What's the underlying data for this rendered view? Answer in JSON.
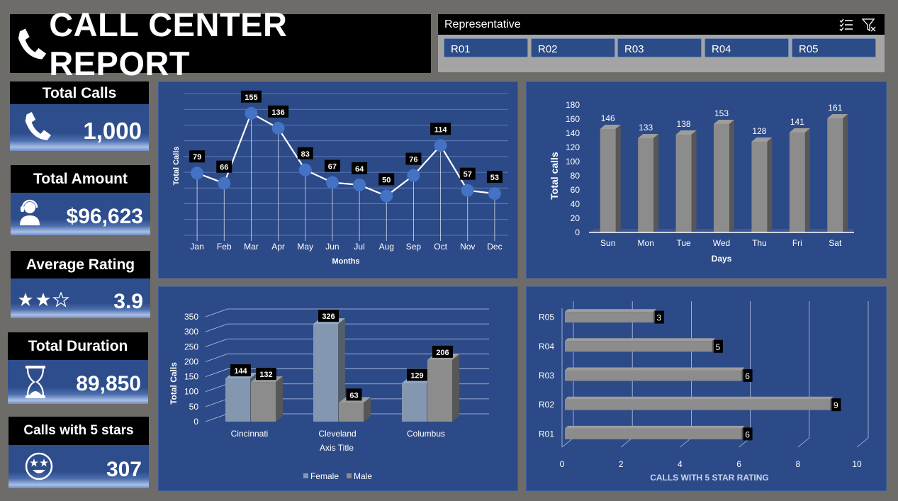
{
  "header": {
    "title": "CALL CENTER REPORT"
  },
  "slicer": {
    "title": "Representative",
    "items": [
      "R01",
      "R02",
      "R03",
      "R04",
      "R05"
    ],
    "icons": [
      "multi-select-icon",
      "clear-filter-icon"
    ]
  },
  "kpis": [
    {
      "label": "Total Calls",
      "value": "1,000",
      "icon": "phone-icon"
    },
    {
      "label": "Total Amount",
      "value": "$96,623",
      "icon": "headset-agent-icon"
    },
    {
      "label": "Average Rating",
      "value": "3.9",
      "icon": "star-rating-icon",
      "rating": 3
    },
    {
      "label": "Total Duration",
      "value": "89,850",
      "icon": "hourglass-icon"
    },
    {
      "label": "Calls with 5 stars",
      "value": "307",
      "icon": "star-eyes-face-icon"
    }
  ],
  "colors": {
    "panel": "#2c4a88",
    "accent_blue": "#4472c4",
    "bar_gray": "#8c8c8c",
    "female": "#8497b0",
    "male": "#8c8c8c"
  },
  "chart_data": [
    {
      "type": "line",
      "categories": [
        "Jan",
        "Feb",
        "Mar",
        "Apr",
        "May",
        "Jun",
        "Jul",
        "Aug",
        "Sep",
        "Oct",
        "Nov",
        "Dec"
      ],
      "values": [
        79,
        66,
        155,
        136,
        83,
        67,
        64,
        50,
        76,
        114,
        57,
        53
      ],
      "xlabel": "Months",
      "ylabel": "Total Calls",
      "ylim": [
        0,
        180
      ],
      "grid": true
    },
    {
      "type": "bar",
      "categories": [
        "Sun",
        "Mon",
        "Tue",
        "Wed",
        "Thu",
        "Fri",
        "Sat"
      ],
      "values": [
        146,
        133,
        138,
        153,
        128,
        141,
        161
      ],
      "xlabel": "Days",
      "ylabel": "Total calls",
      "ylim": [
        0,
        180
      ],
      "yticks": [
        0,
        20,
        40,
        60,
        80,
        100,
        120,
        140,
        160,
        180
      ],
      "grid": false
    },
    {
      "type": "bar",
      "categories": [
        "Cincinnati",
        "Cleveland",
        "Columbus"
      ],
      "series": [
        {
          "name": "Female",
          "values": [
            144,
            326,
            129
          ]
        },
        {
          "name": "Male",
          "values": [
            132,
            63,
            206
          ]
        }
      ],
      "xlabel": "Axis Title",
      "ylabel": "Total Calls",
      "ylim": [
        0,
        350
      ],
      "yticks": [
        0,
        50,
        100,
        150,
        200,
        250,
        300,
        350
      ],
      "legend": "bottom",
      "grid": true
    },
    {
      "type": "bar",
      "orientation": "horizontal",
      "categories": [
        "R01",
        "R02",
        "R03",
        "R04",
        "R05"
      ],
      "values": [
        6,
        9,
        6,
        5,
        3
      ],
      "xlabel": "CALLS WITH 5 STAR RATING",
      "xlim": [
        0,
        10
      ],
      "xticks": [
        0,
        2,
        4,
        6,
        8,
        10
      ],
      "grid": true
    }
  ]
}
